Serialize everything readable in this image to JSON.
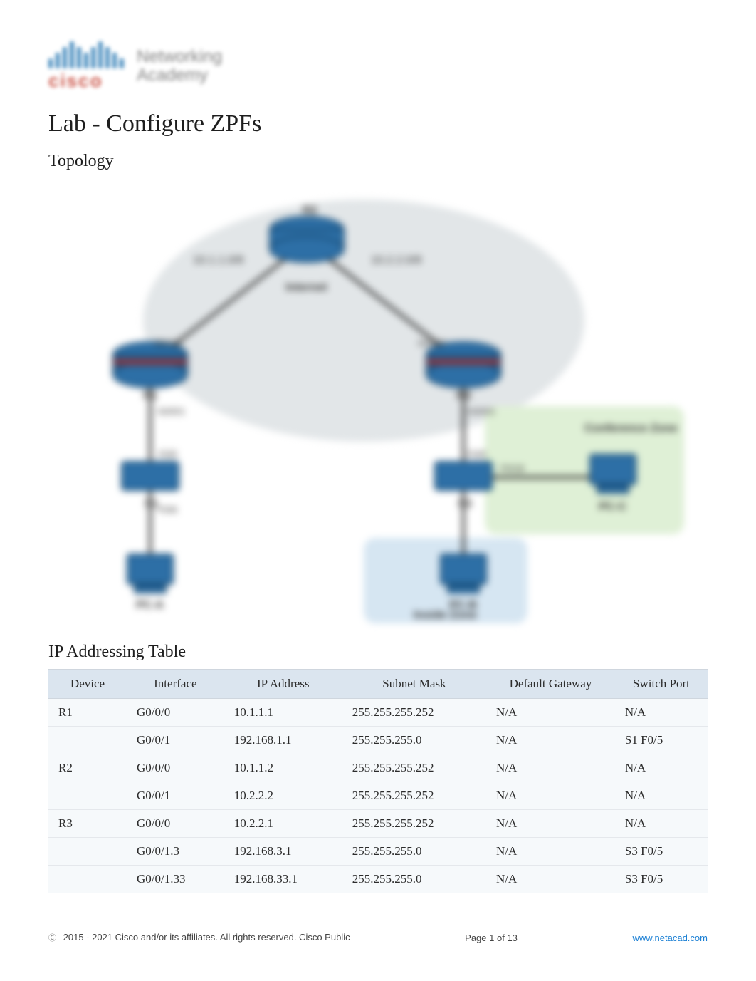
{
  "logo": {
    "brand": "cisco",
    "line1": "Networking",
    "line2": "Academy"
  },
  "title": "Lab - Configure ZPFs",
  "sections": {
    "topology": "Topology",
    "ip_table": "IP Addressing Table"
  },
  "topology": {
    "labels": {
      "internet": "Internet",
      "r1": "R1",
      "r2": "R2",
      "r3": "R3",
      "s1": "S1",
      "s3": "S3",
      "pc_a": "PC-A",
      "pc_b": "PC-B",
      "pc_c": "PC-C",
      "conference_zone": "Conference\nZone",
      "inside_zone": "Inside Zone",
      "link_101108": "10.1.1.0/8",
      "link_102208": "10.2.2.0/8",
      "g000_a": "G0/0/0",
      "g000_b": "G0/0/0",
      "g001_a": "G0/0/1",
      "g001_b": "G0/0/1",
      "f05_a": "F0/5",
      "f05_b": "F0/5",
      "f06": "F0/6",
      "f018": "F0/18"
    }
  },
  "table": {
    "headers": [
      "Device",
      "Interface",
      "IP Address",
      "Subnet Mask",
      "Default Gateway",
      "Switch Port"
    ],
    "rows": [
      [
        "R1",
        "G0/0/0",
        "10.1.1.1",
        "255.255.255.252",
        "N/A",
        "N/A"
      ],
      [
        "",
        "G0/0/1",
        "192.168.1.1",
        "255.255.255.0",
        "N/A",
        "S1 F0/5"
      ],
      [
        "R2",
        "G0/0/0",
        "10.1.1.2",
        "255.255.255.252",
        "N/A",
        "N/A"
      ],
      [
        "",
        "G0/0/1",
        "10.2.2.2",
        "255.255.255.252",
        "N/A",
        "N/A"
      ],
      [
        "R3",
        "G0/0/0",
        "10.2.2.1",
        "255.255.255.252",
        "N/A",
        "N/A"
      ],
      [
        "",
        "G0/0/1.3",
        "192.168.3.1",
        "255.255.255.0",
        "N/A",
        "S3 F0/5"
      ],
      [
        "",
        "G0/0/1.33",
        "192.168.33.1",
        "255.255.255.0",
        "N/A",
        "S3 F0/5"
      ]
    ]
  },
  "footer": {
    "copyright": "2015 - 2021 Cisco and/or its affiliates. All rights reserved. Cisco Public",
    "page_prefix": "Page ",
    "page": "1",
    "page_of": " of 13",
    "link": "www.netacad.com"
  }
}
